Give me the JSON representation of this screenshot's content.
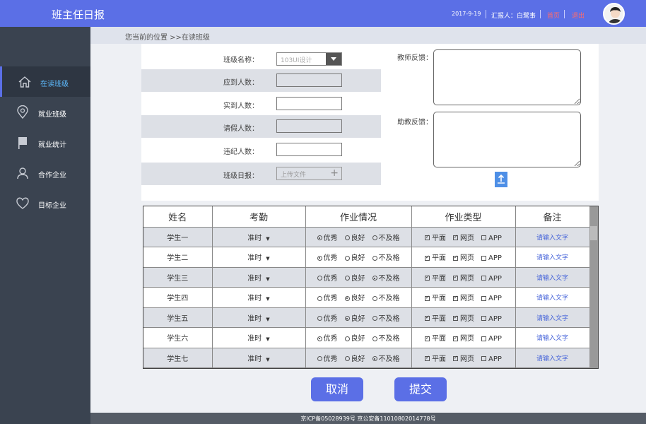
{
  "app": {
    "title": "班主任日报"
  },
  "header": {
    "date": "2017-9-19",
    "reporter": "汇报人：白鹭事",
    "link1": "首页",
    "link2": "退出"
  },
  "sidebar": {
    "items": [
      {
        "label": "在读班级",
        "icon": "home-icon",
        "active": true
      },
      {
        "label": "就业班级",
        "icon": "location-pin-icon"
      },
      {
        "label": "就业统计",
        "icon": "flag-icon"
      },
      {
        "label": "合作企业",
        "icon": "user-icon"
      },
      {
        "label": "目标企业",
        "icon": "heart-icon"
      }
    ]
  },
  "breadcrumb": {
    "text": "您当前的位置 >>在读班级"
  },
  "form": {
    "class_name_label": "班级名称：",
    "class_name_value": "103UI设计",
    "expected_label": "应到人数：",
    "actual_label": "实到人数：",
    "leave_label": "请假人数：",
    "violation_label": "违纪人数：",
    "daily_label": "班级日报：",
    "upload_placeholder": "上传文件",
    "teacher_feedback_label": "教师反馈：",
    "assistant_feedback_label": "助教反馈："
  },
  "table": {
    "headers": [
      "姓名",
      "考勤",
      "作业情况",
      "作业类型",
      "备注"
    ],
    "attendance_value": "准时",
    "hw_options": [
      "优秀",
      "良好",
      "不及格"
    ],
    "type_options": [
      "平面",
      "网页",
      "APP"
    ],
    "note_text": "请输入文字",
    "rows": [
      {
        "name": "学生一",
        "hw": 0
      },
      {
        "name": "学生二",
        "hw": 0
      },
      {
        "name": "学生三",
        "hw": 2
      },
      {
        "name": "学生四",
        "hw": 1
      },
      {
        "name": "学生五",
        "hw": 1
      },
      {
        "name": "学生六",
        "hw": 0
      },
      {
        "name": "学生七",
        "hw": 2
      }
    ]
  },
  "buttons": {
    "cancel": "取消",
    "submit": "提交"
  },
  "footer": {
    "text": "京ICP备05028939号 京公安备11010802014778号"
  },
  "colors": {
    "accent": "#5b6fe6",
    "sidebar": "#3a4350",
    "active_text": "#5dbbff"
  }
}
